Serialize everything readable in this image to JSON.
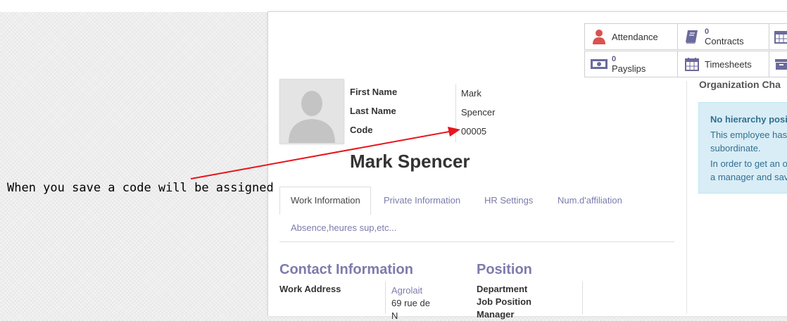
{
  "smart_buttons": {
    "attendance": {
      "label": "Attendance",
      "icon": "user-icon"
    },
    "contracts": {
      "count": "0",
      "label": "Contracts",
      "icon": "book-icon"
    },
    "payslips": {
      "count": "0",
      "label": "Payslips",
      "icon": "money-icon"
    },
    "timesheets": {
      "label": "Timesheets",
      "icon": "calendar-icon"
    }
  },
  "employee": {
    "fields": {
      "first_name_label": "First Name",
      "first_name": "Mark",
      "last_name_label": "Last Name",
      "last_name": "Spencer",
      "code_label": "Code",
      "code": "00005"
    },
    "display_name": "Mark Spencer"
  },
  "annotation": {
    "text": "When you save a code will be assigned",
    "arrow_color": "#e8141b"
  },
  "tabs": [
    {
      "label": "Work Information",
      "active": true
    },
    {
      "label": "Private Information"
    },
    {
      "label": "HR Settings"
    },
    {
      "label": "Num.d'affiliation"
    },
    {
      "label": "Absence,heures sup,etc..."
    }
  ],
  "contact": {
    "title": "Contact Information",
    "work_address_label": "Work Address",
    "work_address_company": "Agrolait",
    "work_address_line": "69 rue de",
    "work_address_line2": "N"
  },
  "position": {
    "title": "Position",
    "department_label": "Department",
    "job_position_label": "Job Position",
    "manager_label": "Manager"
  },
  "org_chart": {
    "title": "Organization Cha",
    "box_title": "No hierarchy posi",
    "line1": "This employee has",
    "line2": "subordinate.",
    "line3": "In order to get an o",
    "line4": "a manager and sav"
  },
  "colors": {
    "accent": "#7c7bad",
    "info_bg": "#d9edf7",
    "info_text": "#31708f",
    "annotation_arrow": "#e8141b"
  }
}
